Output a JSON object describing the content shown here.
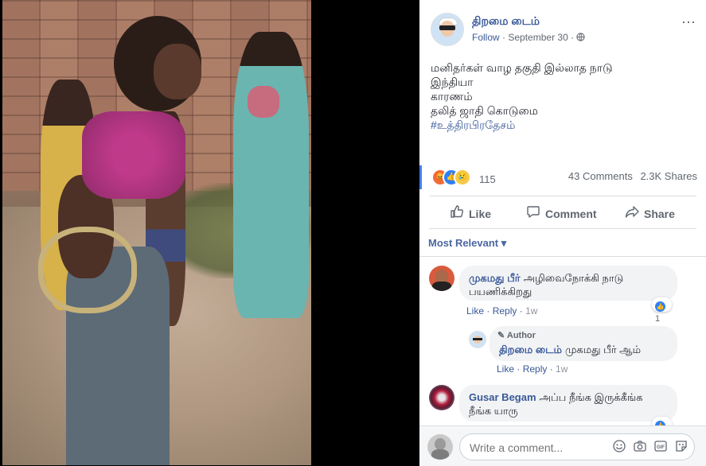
{
  "post": {
    "page_name": "திறமை டைம்",
    "follow_label": "Follow",
    "separator": "·",
    "date": "September 30",
    "privacy_icon": "globe-icon",
    "more_label": "⋯",
    "text_lines": [
      "மனிதர்கள் வாழ தகுதி இல்லாத நாடு",
      "இந்தியா",
      "காரணம்",
      "தலித் ஜாதி கொடுமை"
    ],
    "hashtag": "#உத்திரபிரதேசம்"
  },
  "stats": {
    "reaction_count": "115",
    "comments": "43 Comments",
    "shares": "2.3K Shares",
    "reaction_icons": [
      "angry-icon",
      "like-icon",
      "sad-icon"
    ]
  },
  "actions": {
    "like": "Like",
    "comment": "Comment",
    "share": "Share"
  },
  "sort_label": "Most Relevant ▾",
  "comments": [
    {
      "author": "முகமது பீர்",
      "text": "அழிவைநோக்கி நாடு பயணிக்கிறது",
      "like": "Like",
      "reply": "Reply",
      "time": "1w",
      "likes": "1"
    },
    {
      "author_tag": "Author",
      "author": "திறமை டைம்",
      "text": "முகமது பீர் ஆம்",
      "like": "Like",
      "reply": "Reply",
      "time": "1w"
    },
    {
      "author": "Gusar Begam",
      "text": "அப்ப நீங்க இருக்கீங்க நீங்க யாரு",
      "likes": "1"
    }
  ],
  "composer": {
    "placeholder": "Write a comment...",
    "tools": [
      "emoji-icon",
      "camera-icon",
      "gif-icon",
      "sticker-icon"
    ]
  },
  "colors": {
    "link": "#385898",
    "meta": "#606770",
    "bubble": "#f2f3f5",
    "accent": "#4080ff"
  }
}
